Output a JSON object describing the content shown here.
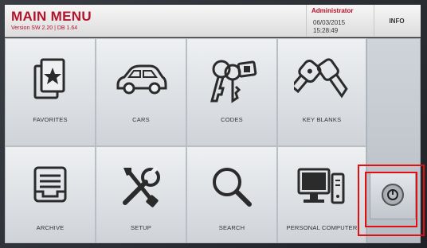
{
  "header": {
    "title": "MAIN MENU",
    "version": "Version SW 2.20 | DB 1.64",
    "user": "Administrator",
    "date": "06/03/2015",
    "time": "15:28:49",
    "info_label": "INFO"
  },
  "menu": {
    "favorites": "FAVORITES",
    "cars": "CARS",
    "codes": "CODES",
    "key_blanks": "KEY BLANKS",
    "archive": "ARCHIVE",
    "setup": "SETUP",
    "search": "SEARCH",
    "personal_computer": "PERSONAL COMPUTER"
  },
  "colors": {
    "brand": "#b3122a",
    "highlight": "#e01010"
  }
}
